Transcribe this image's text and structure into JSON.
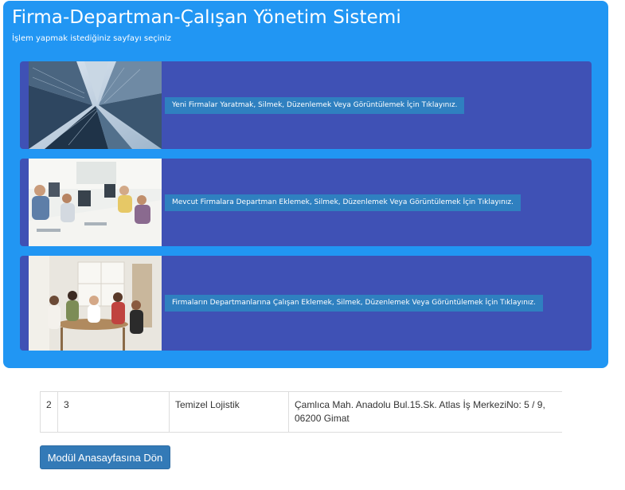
{
  "header": {
    "title": "Firma-Departman-Çalışan Yönetim Sistemi",
    "subtitle": "İşlem yapmak istediğiniz sayfayı seçiniz"
  },
  "cards": [
    {
      "image": "office-skyscrapers-photo",
      "link_text": "Yeni Firmalar Yaratmak, Silmek, Düzenlemek Veya Görüntülemek İçin Tıklayınız."
    },
    {
      "image": "office-workers-at-desks-photo",
      "link_text": "Mevcut Firmalara Departman Eklemek, Silmek, Düzenlemek Veya Görüntülemek İçin Tıklayınız."
    },
    {
      "image": "team-meeting-photo",
      "link_text": "Firmaların Departmanlarına Çalışan Eklemek, Silmek, Düzenlemek Veya Görüntülemek İçin Tıklayınız."
    }
  ],
  "table": {
    "rows": [
      [
        "2",
        "3",
        "Temizel Lojistik",
        "Çamlıca Mah. Anadolu Bul.15.Sk. Atlas İş MerkeziNo: 5 / 9, 06200 Gimat"
      ]
    ]
  },
  "back_button": {
    "label": "Modül Anasayfasına Dön"
  },
  "colors": {
    "hero_bg": "#2196f3",
    "card_bg": "#3f51b5",
    "link_bg": "#2f80c0",
    "button_bg": "#337ab7"
  }
}
